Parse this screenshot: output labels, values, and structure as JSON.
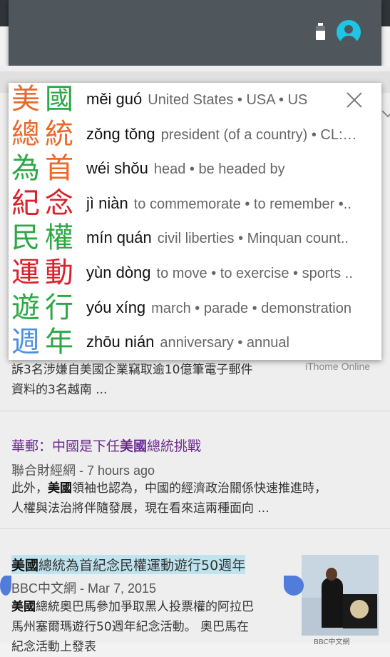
{
  "popup": {
    "entries": [
      {
        "chars": [
          "美",
          "國"
        ],
        "colors": [
          "#e86a2c",
          "#2ca845"
        ],
        "pinyin": "měi guó",
        "definition": "United States • USA • US"
      },
      {
        "chars": [
          "總",
          "統"
        ],
        "colors": [
          "#e86a2c",
          "#e86a2c"
        ],
        "pinyin": "zǒng tǒng",
        "definition": "president (of a country) • CL:…"
      },
      {
        "chars": [
          "為",
          "首"
        ],
        "colors": [
          "#2ca845",
          "#e86a2c"
        ],
        "pinyin": "wéi shǒu",
        "definition": "head • be headed by"
      },
      {
        "chars": [
          "紀",
          "念"
        ],
        "colors": [
          "#d8232a",
          "#d8232a"
        ],
        "pinyin": "jì niàn",
        "definition": "to commemorate • to remember •.."
      },
      {
        "chars": [
          "民",
          "權"
        ],
        "colors": [
          "#2ca845",
          "#2ca845"
        ],
        "pinyin": "mín quán",
        "definition": "civil liberties • Minquan count.."
      },
      {
        "chars": [
          "運",
          "動"
        ],
        "colors": [
          "#d8232a",
          "#d8232a"
        ],
        "pinyin": "yùn dòng",
        "definition": "to move • to exercise • sports .."
      },
      {
        "chars": [
          "遊",
          "行"
        ],
        "colors": [
          "#2ca845",
          "#2ca845"
        ],
        "pinyin": "yóu xíng",
        "definition": "march • parade • demonstration"
      },
      {
        "chars": [
          "週",
          "年"
        ],
        "colors": [
          "#4a90e2",
          "#2ca845"
        ],
        "pinyin": "zhōu nián",
        "definition": "anniversary • annual"
      }
    ]
  },
  "results": {
    "r1_source": "iThome Online",
    "r1_snippet_line1": "訴3名涉嫌自美國企業竊取逾10億筆電子郵件",
    "r1_snippet_line2": "資料的3名越南 ...",
    "r2_title_a": "華郵：中國是下任",
    "r2_title_b": "美國",
    "r2_title_c": "總統挑戰",
    "r2_source": "聯合財經網",
    "r2_time": "7 hours ago",
    "r2_snippet_a": "此外，",
    "r2_snippet_b": "美國",
    "r2_snippet_c": "領袖也認為，中國的經濟政治關係快速推進時，",
    "r2_snippet_line2": "人權與法治將伴隨發展，現在看來這兩種面向 ...",
    "r3_title_a": "美國",
    "r3_title_b": "總統為首紀念民權運動遊行50週年",
    "r3_source": "BBC中文網",
    "r3_time": "Mar 7, 2015",
    "r3_snippet_a": "美國",
    "r3_snippet_b": "總統奧巴馬參加爭取黑人投票權的阿拉巴",
    "r3_snippet_line2": "馬州塞爾瑪遊行50週年紀念活動。 奧巴馬在",
    "r3_snippet_line3": "紀念活動上發表",
    "r3_thumb_caption": "BBC中文網"
  },
  "icons": {
    "battery": "battery-icon",
    "account": "account-circle-icon",
    "close": "close-icon",
    "expand": "chevron-down-icon"
  }
}
